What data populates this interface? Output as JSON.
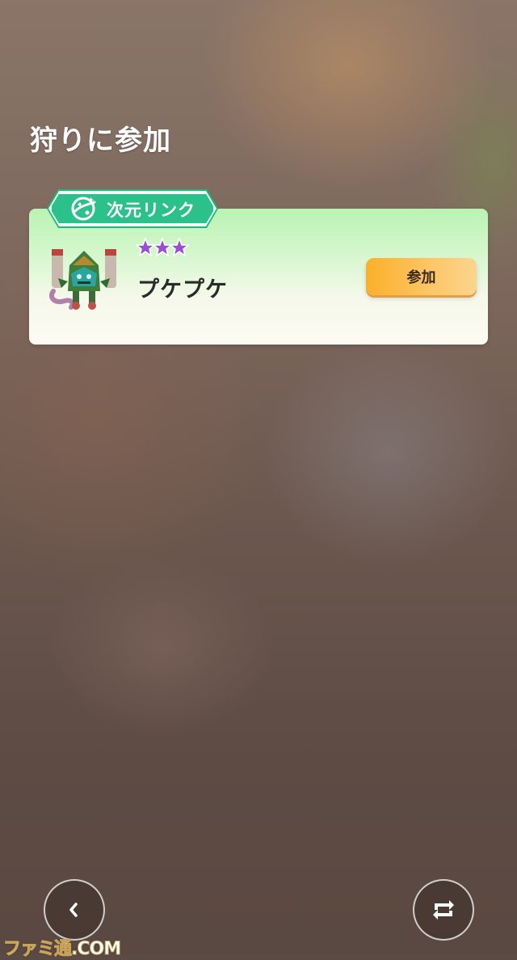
{
  "screen": {
    "title": "狩りに参加"
  },
  "raid_card": {
    "tag_label": "次元リンク",
    "tag_icon": "dimension-link-icon",
    "pokemon_name": "プケプケ",
    "star_rating": 3,
    "join_label": "参加"
  },
  "nav": {
    "back_icon": "chevron-left-icon",
    "swap_icon": "swap-arrows-icon"
  },
  "watermark": {
    "text": "ファミ通.COM"
  },
  "colors": {
    "tag_green": "#2cc08a",
    "join_orange": "#fbb02a",
    "star_purple": "#9b4fd0"
  }
}
